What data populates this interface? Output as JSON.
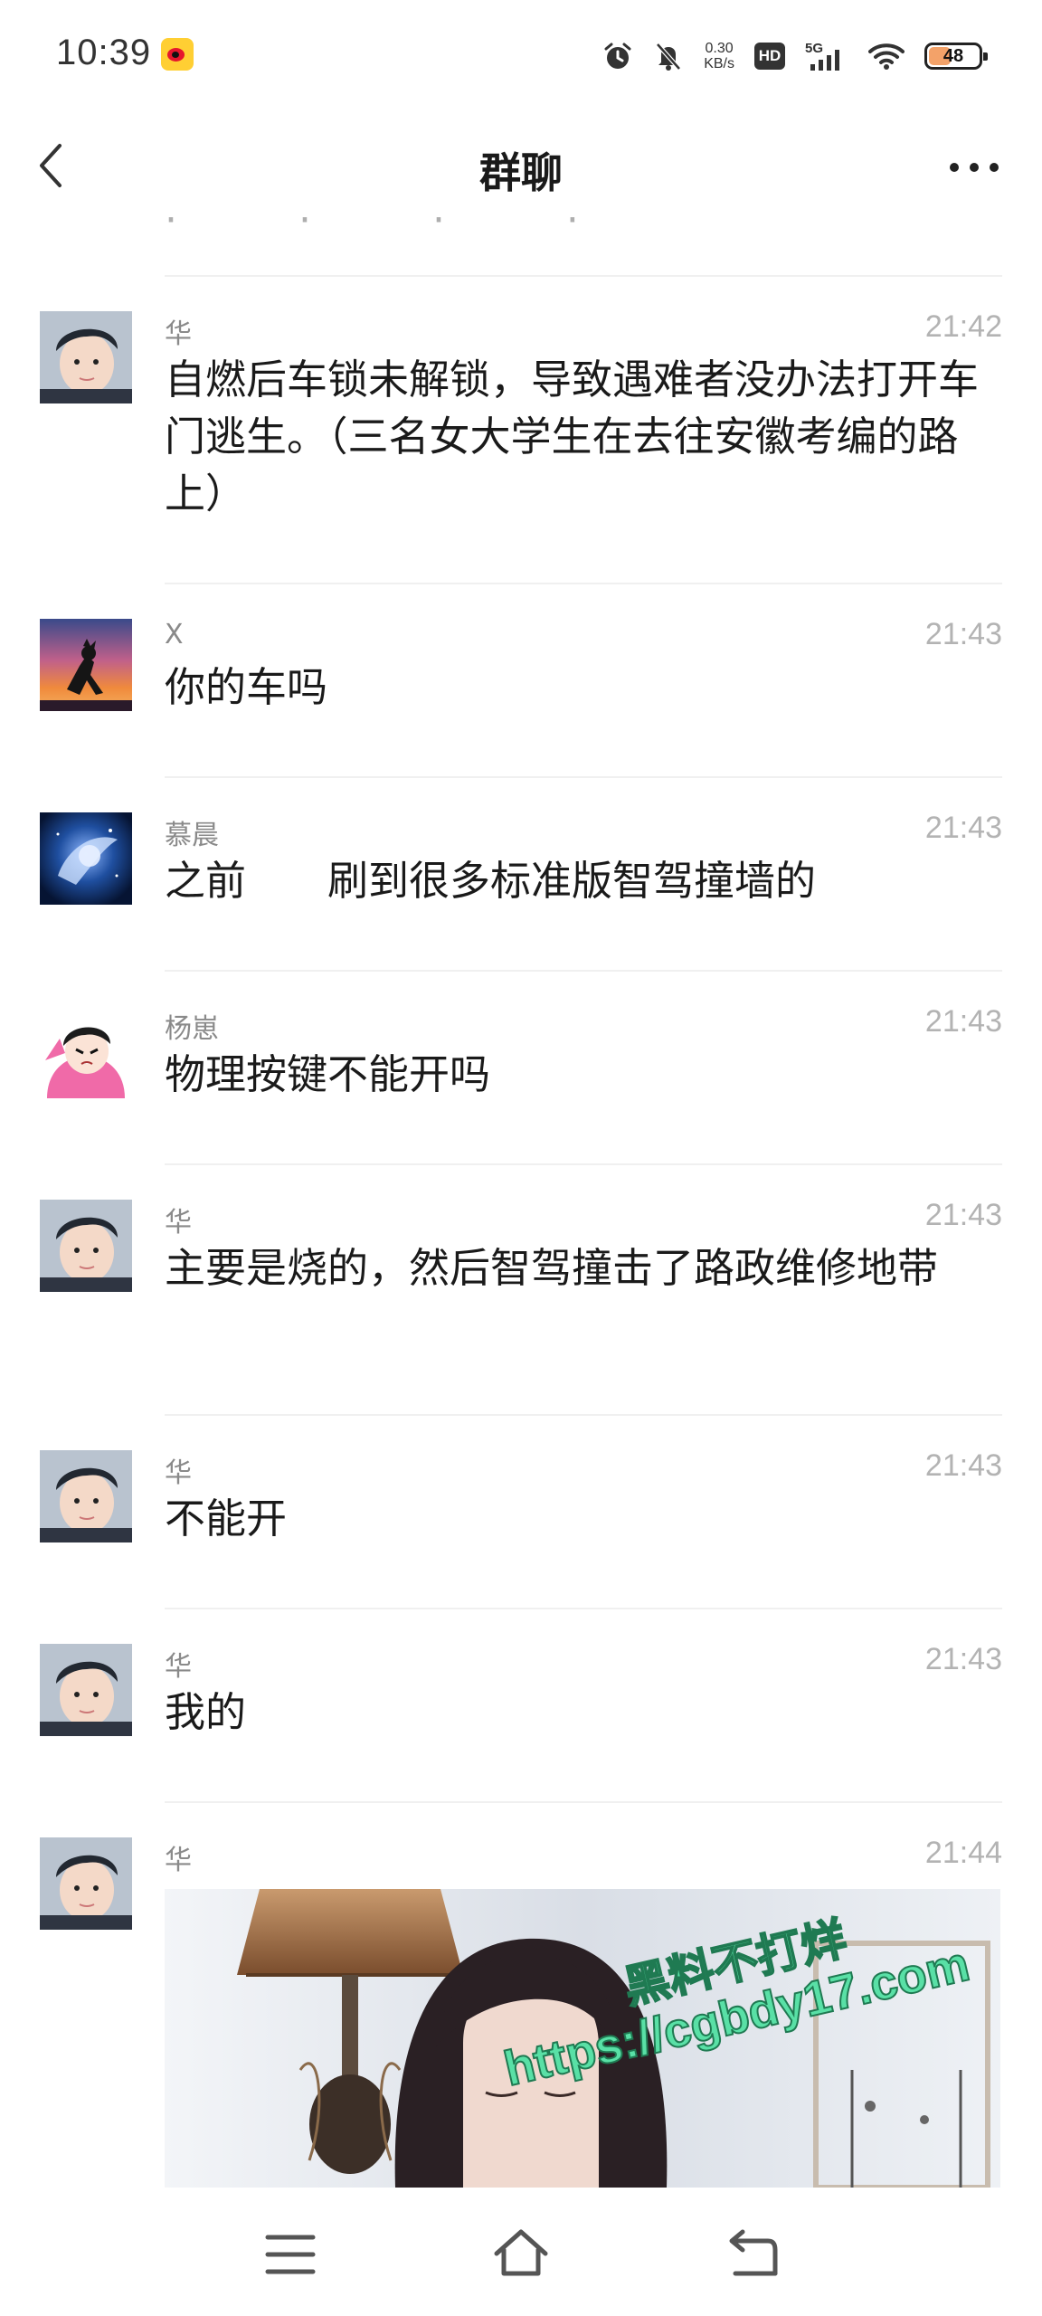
{
  "status_bar": {
    "time": "10:39",
    "net_speed_value": "0.30",
    "net_speed_unit": "KB/s",
    "hd_label": "HD",
    "signal_label": "5G",
    "battery": "48",
    "battery_level": 0.48,
    "app_icon": "weibo-icon",
    "colors": {
      "battery_fill": "#f3a269"
    }
  },
  "header": {
    "title": "群聊",
    "back_icon": "chevron-left-icon",
    "more_icon": "ellipsis-icon"
  },
  "messages": [
    {
      "name": "华",
      "time": "21:42",
      "text": "自燃后车锁未解锁，导致遇难者没办法打开车门逃生。（三名女大学生在去往安徽考编的路上）",
      "avatar": "avatar-boy"
    },
    {
      "name": "X",
      "time": "21:43",
      "text": "你的车吗",
      "avatar": "avatar-sunset"
    },
    {
      "name": "慕晨",
      "time": "21:43",
      "text": "之前　　刷到很多标准版智驾撞墙的",
      "avatar": "avatar-blue-anime"
    },
    {
      "name": "杨崽",
      "time": "21:43",
      "text": "物理按键不能开吗",
      "avatar": "avatar-pink-hoodie"
    },
    {
      "name": "华",
      "time": "21:43",
      "text": "主要是烧的，然后智驾撞击了路政维修地带",
      "avatar": "avatar-boy"
    },
    {
      "name": "华",
      "time": "21:43",
      "text": "不能开",
      "avatar": "avatar-boy"
    },
    {
      "name": "华",
      "time": "21:43",
      "text": "我的",
      "avatar": "avatar-boy"
    },
    {
      "name": "华",
      "time": "21:44",
      "text": "",
      "avatar": "avatar-boy",
      "image": "photo-girl-lamp"
    }
  ],
  "image_watermark": {
    "line1": "黑料不打烊",
    "line2": "https://cgbdy17.com"
  },
  "nav_bar": {
    "menu_icon": "menu-icon",
    "home_icon": "home-icon",
    "back_icon": "back-icon"
  }
}
